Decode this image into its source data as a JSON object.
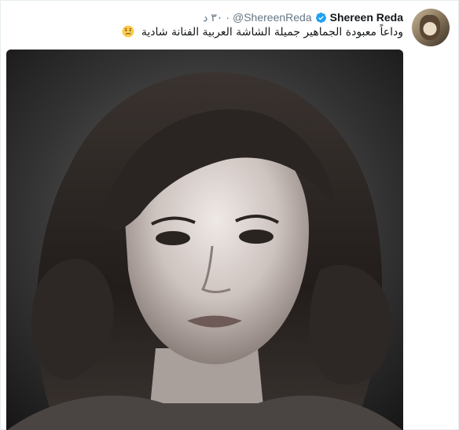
{
  "tweet": {
    "display_name": "Shereen Reda",
    "handle": "@ShereenReda",
    "separator": "·",
    "time": "٣٠ د",
    "text": "وداعاً معبودة الجماهير جميلة الشاشة العربية الفنانة شادية",
    "emoji": "crying-face",
    "verified_color": "#1da1f2",
    "name_color": "#14171a",
    "muted_color": "#657786"
  },
  "icons": {
    "verified": "verified-badge-icon",
    "emoji": "crying-face-emoji"
  }
}
